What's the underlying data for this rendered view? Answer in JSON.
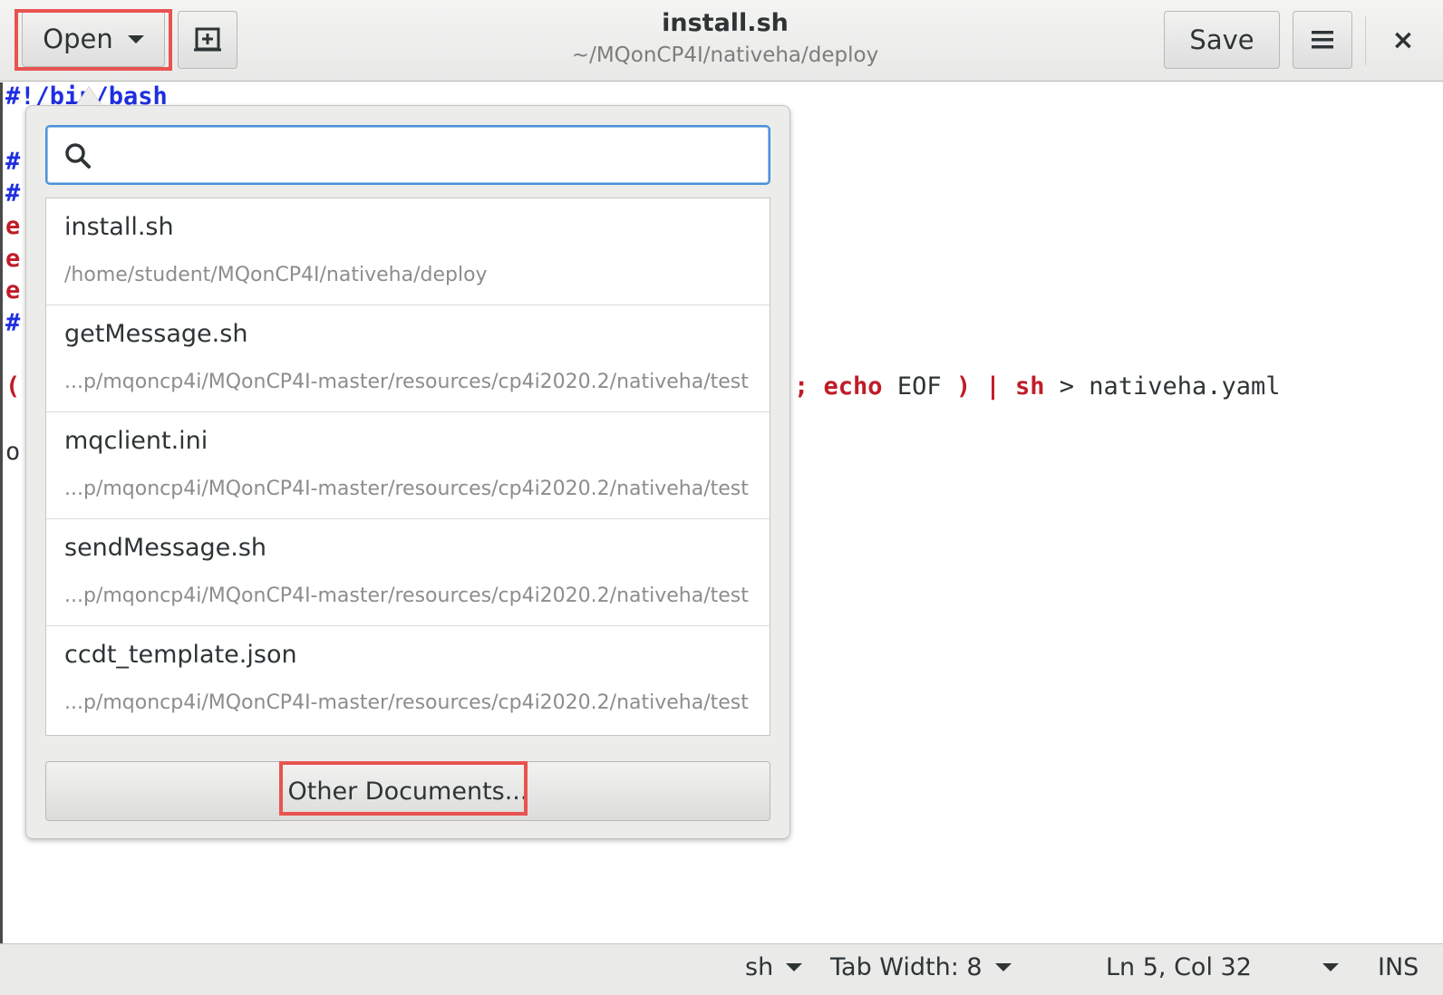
{
  "header": {
    "open_label": "Open",
    "title": "install.sh",
    "subtitle": "~/MQonCP4I/nativeha/deploy",
    "save_label": "Save",
    "close_label": "×"
  },
  "editor": {
    "shebang": "#!/bin/bash",
    "line_hash1": "#",
    "line_hash2": "#",
    "line_e1": "e",
    "line_e2": "e",
    "line_e3": "e",
    "line_hash3": "#",
    "line_paren": "(",
    "line_tail_semicolon": ";",
    "line_tail_echo": "echo",
    "line_tail_eof": "EOF",
    "line_tail_close": ")",
    "line_tail_pipe": "|",
    "line_tail_sh": "sh",
    "line_tail_redirect": "> nativeha.yaml",
    "line_o": "o"
  },
  "popover": {
    "search_placeholder": "",
    "recent_files": [
      {
        "name": "install.sh",
        "path": "/home/student/MQonCP4I/nativeha/deploy"
      },
      {
        "name": "getMessage.sh",
        "path": "...p/mqoncp4i/MQonCP4I-master/resources/cp4i2020.2/nativeha/test"
      },
      {
        "name": "mqclient.ini",
        "path": "...p/mqoncp4i/MQonCP4I-master/resources/cp4i2020.2/nativeha/test"
      },
      {
        "name": "sendMessage.sh",
        "path": "...p/mqoncp4i/MQonCP4I-master/resources/cp4i2020.2/nativeha/test"
      },
      {
        "name": "ccdt_template.json",
        "path": "...p/mqoncp4i/MQonCP4I-master/resources/cp4i2020.2/nativeha/test"
      }
    ],
    "other_documents_label": "Other Documents..."
  },
  "statusbar": {
    "language": "sh",
    "tab_width": "Tab Width: 8",
    "position": "Ln 5, Col 32",
    "mode": "INS"
  },
  "colors": {
    "highlight": "#e8534f",
    "search_focus": "#4a90d9",
    "keyword_blue": "#1f2fe0",
    "keyword_red": "#c01c28"
  }
}
